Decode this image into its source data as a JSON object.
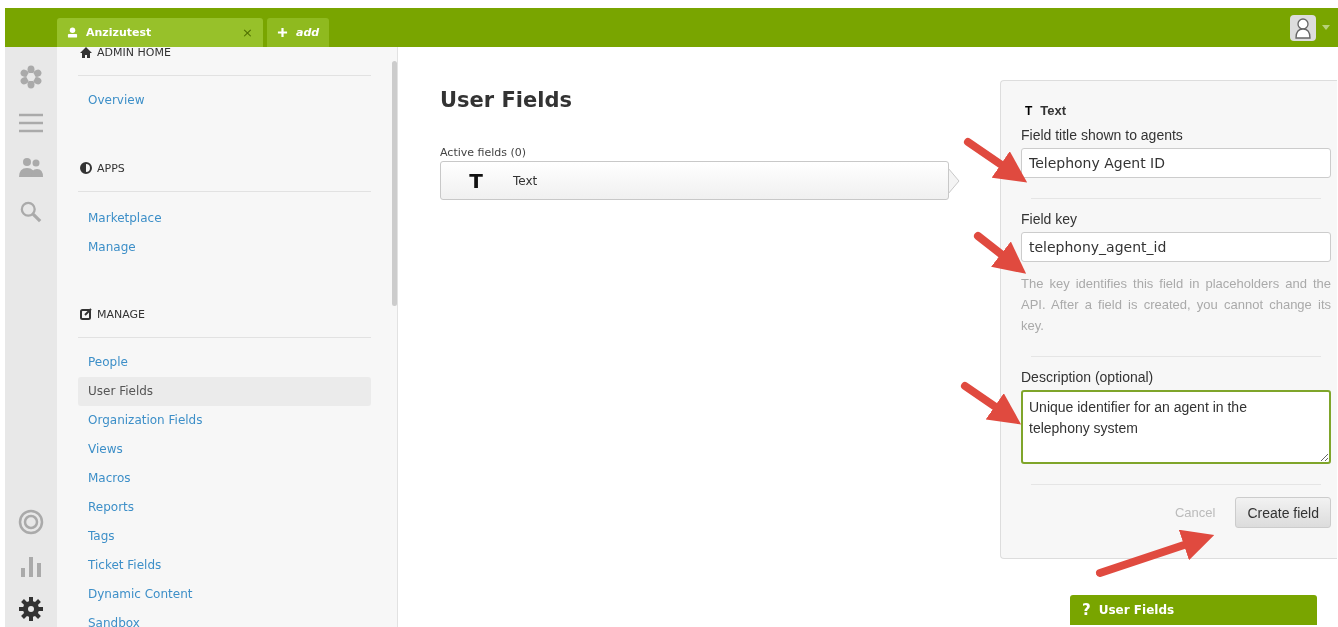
{
  "tabs": [
    {
      "label": "Anzizutest",
      "close": "×",
      "kind": "user"
    },
    {
      "label": "add",
      "kind": "add"
    }
  ],
  "sidebar": {
    "sections": [
      {
        "title": "ADMIN HOME",
        "items": [
          {
            "label": "Overview",
            "selected": false
          }
        ]
      },
      {
        "title": "APPS",
        "items": [
          {
            "label": "Marketplace",
            "selected": false
          },
          {
            "label": "Manage",
            "selected": false
          }
        ]
      },
      {
        "title": "MANAGE",
        "items": [
          {
            "label": "People",
            "selected": false
          },
          {
            "label": "User Fields",
            "selected": true
          },
          {
            "label": "Organization Fields",
            "selected": false
          },
          {
            "label": "Views",
            "selected": false
          },
          {
            "label": "Macros",
            "selected": false
          },
          {
            "label": "Reports",
            "selected": false
          },
          {
            "label": "Tags",
            "selected": false
          },
          {
            "label": "Ticket Fields",
            "selected": false
          },
          {
            "label": "Dynamic Content",
            "selected": false
          },
          {
            "label": "Sandbox",
            "selected": false
          }
        ]
      }
    ]
  },
  "main": {
    "title": "User Fields",
    "active_fields_label": "Active fields (0)",
    "field_types": [
      {
        "glyph": "T",
        "label": "Text",
        "selected": true
      }
    ]
  },
  "form": {
    "glyph": "T",
    "heading": "Text",
    "title_label": "Field title shown to agents",
    "title_value": "Telephony Agent ID",
    "key_label": "Field key",
    "key_value": "telephony_agent_id",
    "key_hint": "The key identifies this field in placeholders and the API. After a field is created, you cannot change its key.",
    "description_label": "Description (optional)",
    "description_value": "Unique identifier for an agent in the telephony system",
    "cancel": "Cancel",
    "submit": "Create field"
  },
  "help_box": {
    "glyph": "?",
    "title": "User Fields"
  }
}
